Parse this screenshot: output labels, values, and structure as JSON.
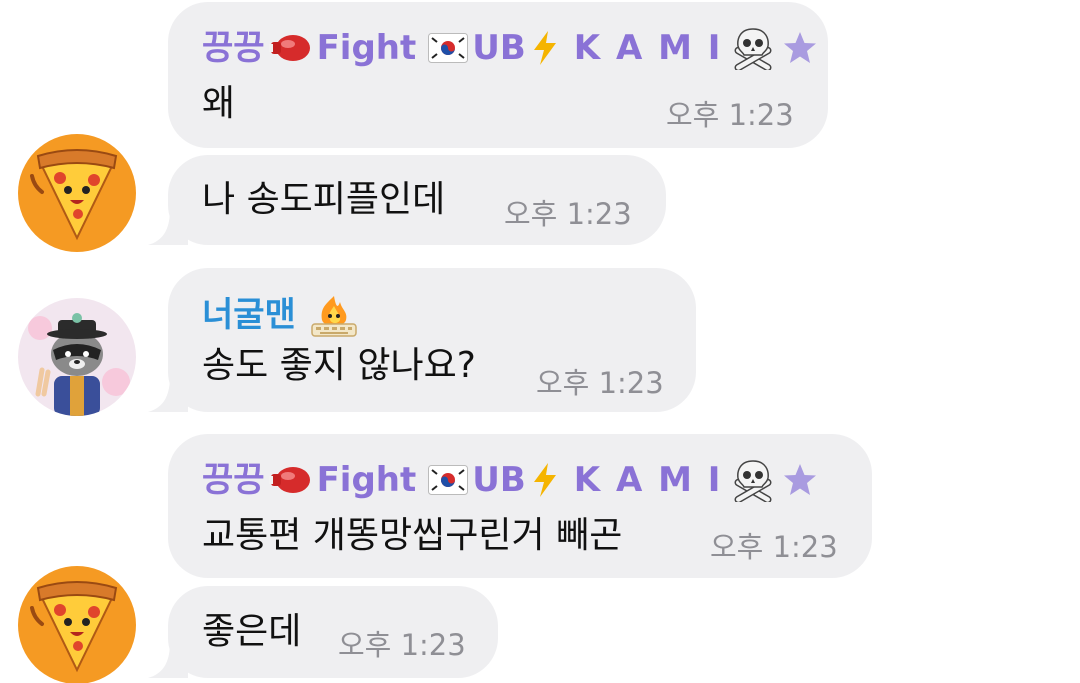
{
  "messages": [
    {
      "sender": {
        "name_a": "끙끙",
        "name_b": "Fight",
        "name_c": "UB",
        "name_d": "K A M I",
        "icons": [
          "boxing-glove-icon",
          "korea-flag-icon",
          "lightning-icon",
          "skull-crossbones-icon",
          "star-icon"
        ]
      },
      "text": "왜",
      "time": "오후 1:23"
    },
    {
      "avatar": "pizza-avatar",
      "text": "나 송도피플인데",
      "time": "오후 1:23"
    },
    {
      "avatar": "raccoon-avatar",
      "sender": {
        "name": "너굴맨",
        "icons": [
          "fire-keyboard-icon"
        ]
      },
      "text": "송도 좋지 않나요?",
      "time": "오후 1:23"
    },
    {
      "sender": {
        "name_a": "끙끙",
        "name_b": "Fight",
        "name_c": "UB",
        "name_d": "K A M I",
        "icons": [
          "boxing-glove-icon",
          "korea-flag-icon",
          "lightning-icon",
          "skull-crossbones-icon",
          "star-icon"
        ]
      },
      "text": "교통편 개똥망씹구린거 빼곤",
      "time": "오후 1:23"
    },
    {
      "avatar": "pizza-avatar",
      "text": "좋은데",
      "time": "오후 1:23"
    }
  ],
  "colors": {
    "bubble": "#efeff1",
    "sender_purple": "#8a72d6",
    "sender_blue": "#2a8fd6",
    "time": "#8f8f95"
  }
}
